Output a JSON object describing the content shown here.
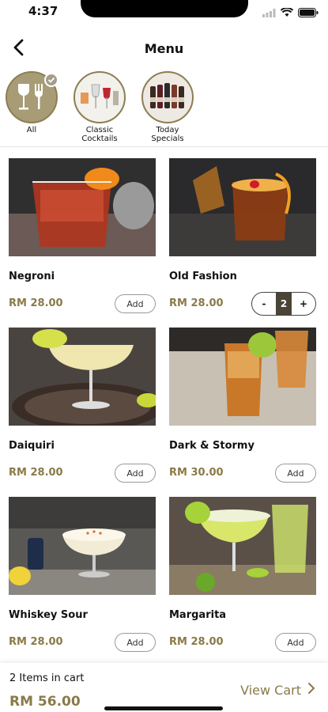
{
  "status_bar": {
    "time": "4:37",
    "icons": [
      "signal-icon",
      "wifi-icon",
      "battery-icon"
    ]
  },
  "header": {
    "title": "Menu",
    "back_icon": "chevron-left-icon"
  },
  "categories": [
    {
      "label": "All",
      "selected": true
    },
    {
      "label": "Classic Cocktails",
      "selected": false
    },
    {
      "label": "Today Specials",
      "selected": false
    }
  ],
  "items": [
    {
      "name": "Negroni",
      "price": "RM 28.00",
      "action": "Add"
    },
    {
      "name": "Old Fashion",
      "price": "RM 28.00",
      "quantity": "2",
      "minus": "-",
      "plus": "+"
    },
    {
      "name": "Daiquiri",
      "price": "RM 28.00",
      "action": "Add"
    },
    {
      "name": "Dark & Stormy",
      "price": "RM 30.00",
      "action": "Add"
    },
    {
      "name": "Whiskey Sour",
      "price": "RM 28.00",
      "action": "Add"
    },
    {
      "name": "Margarita",
      "price": "RM 28.00",
      "action": "Add"
    }
  ],
  "cart": {
    "count_text": "2 Items in cart",
    "total": "RM 56.00",
    "view_label": "View Cart"
  },
  "colors": {
    "accent": "#8a7a48",
    "stepper_dark": "#4a4437"
  }
}
